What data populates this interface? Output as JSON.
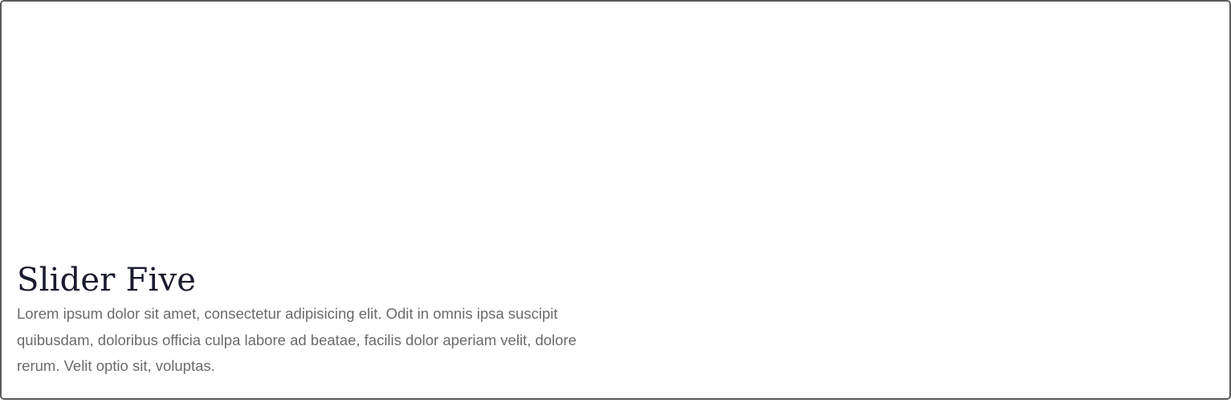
{
  "slide": {
    "title": "Slider Five",
    "description": "Lorem ipsum dolor sit amet, consectetur adipisicing elit. Odit in omnis ipsa suscipit quibusdam, doloribus officia culpa labore ad beatae, facilis dolor aperiam velit, dolore rerum. Velit optio sit, voluptas."
  }
}
